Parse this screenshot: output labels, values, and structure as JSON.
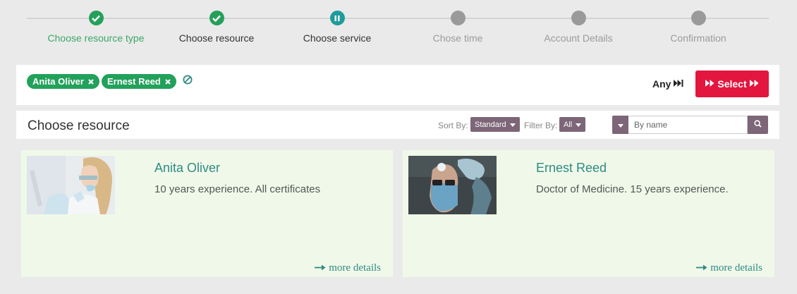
{
  "stepper": {
    "steps": [
      {
        "label": "Choose resource type",
        "state": "done"
      },
      {
        "label": "Choose resource",
        "state": "done"
      },
      {
        "label": "Choose service",
        "state": "active"
      },
      {
        "label": "Chose time",
        "state": "todo"
      },
      {
        "label": "Account Details",
        "state": "todo"
      },
      {
        "label": "Confirmation",
        "state": "todo"
      }
    ]
  },
  "selection": {
    "chips": [
      "Anita Oliver",
      "Ernest Reed"
    ],
    "any_label": "Any",
    "select_label": "Select"
  },
  "resources_header": {
    "title": "Choose resource",
    "sort_label": "Sort By:",
    "sort_value": "Standard",
    "filter_label": "Filter By:",
    "filter_value": "All",
    "search_placeholder": "By name"
  },
  "resources": [
    {
      "name": "Anita Oliver",
      "description": "10 years experience. All certificates",
      "more": "more details"
    },
    {
      "name": "Ernest Reed",
      "description": "Doctor of Medicine. 15 years experience.",
      "more": "more details"
    }
  ],
  "colors": {
    "done": "#25a05a",
    "active": "#1f9b9b",
    "todo": "#9a9a9a",
    "chip": "#22a15b",
    "select_button": "#e2163f",
    "dropdown": "#7d6677",
    "card_bg": "#f0f9e9",
    "card_title": "#2f8a84"
  },
  "icons": {
    "done": "check-icon",
    "active": "pause-icon",
    "chip_remove": "close-icon",
    "clear_all": "ban-icon",
    "any": "fast-forward-icon",
    "select": "double-chevron-icon",
    "search": "search-icon",
    "more": "arrow-right-icon"
  }
}
